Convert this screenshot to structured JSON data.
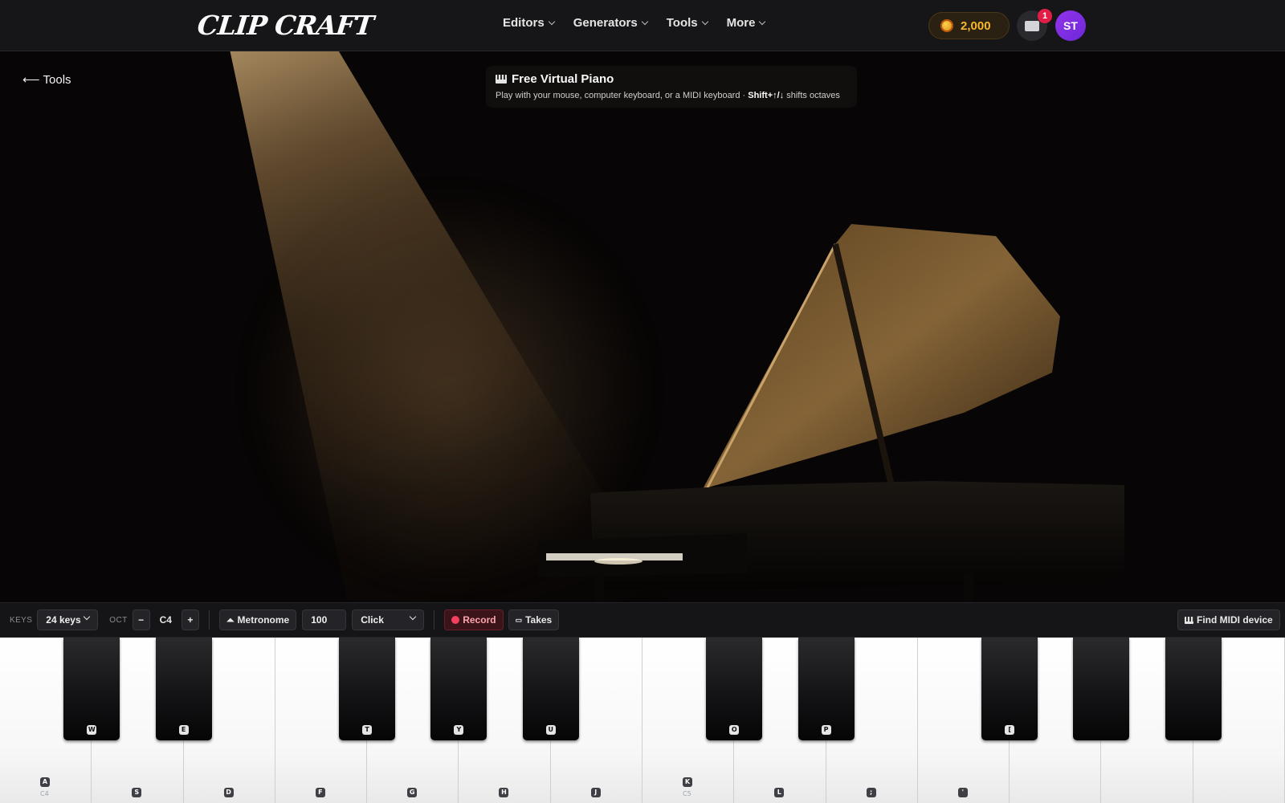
{
  "header": {
    "logo": "CLIP CRAFT",
    "nav": [
      {
        "label": "Editors"
      },
      {
        "label": "Generators"
      },
      {
        "label": "Tools"
      },
      {
        "label": "More"
      }
    ],
    "coins": "2,000",
    "notifications_count": "1",
    "avatar_initials": "ST"
  },
  "hero": {
    "back_label": "Tools",
    "title": "Free Virtual Piano",
    "subtitle_pre": "Play with your mouse, computer keyboard, or a MIDI keyboard · ",
    "subtitle_bold": "Shift+↑/↓",
    "subtitle_post": " shifts octaves"
  },
  "controls": {
    "keys_label": "KEYS",
    "keys_value": "24 keys",
    "oct_label": "OCT",
    "oct_minus": "−",
    "oct_value": "C4",
    "oct_plus": "+",
    "metronome_label": "Metronome",
    "bpm": "100",
    "sound_value": "Click",
    "record_label": "Record",
    "takes_label": "Takes",
    "midi_label": "Find MIDI device"
  },
  "keyboard": {
    "white_keys": [
      {
        "cap": "A",
        "note": "C4"
      },
      {
        "cap": "S",
        "note": ""
      },
      {
        "cap": "D",
        "note": ""
      },
      {
        "cap": "F",
        "note": ""
      },
      {
        "cap": "G",
        "note": ""
      },
      {
        "cap": "H",
        "note": ""
      },
      {
        "cap": "J",
        "note": ""
      },
      {
        "cap": "K",
        "note": "C5"
      },
      {
        "cap": "L",
        "note": ""
      },
      {
        "cap": ";",
        "note": ""
      },
      {
        "cap": "'",
        "note": ""
      },
      {
        "cap": "",
        "note": ""
      },
      {
        "cap": "",
        "note": ""
      },
      {
        "cap": "",
        "note": ""
      }
    ],
    "black_keys": [
      {
        "cap": "W"
      },
      {
        "cap": "E"
      },
      {
        "cap": "T"
      },
      {
        "cap": "Y"
      },
      {
        "cap": "U"
      },
      {
        "cap": "O"
      },
      {
        "cap": "P"
      },
      {
        "cap": "["
      },
      {
        "cap": ""
      },
      {
        "cap": ""
      }
    ]
  },
  "colors": {
    "accent_gold": "#f5b82e",
    "record_red": "#f43f5e",
    "avatar_purple": "#7c3aed",
    "notification_red": "#e11d48"
  }
}
